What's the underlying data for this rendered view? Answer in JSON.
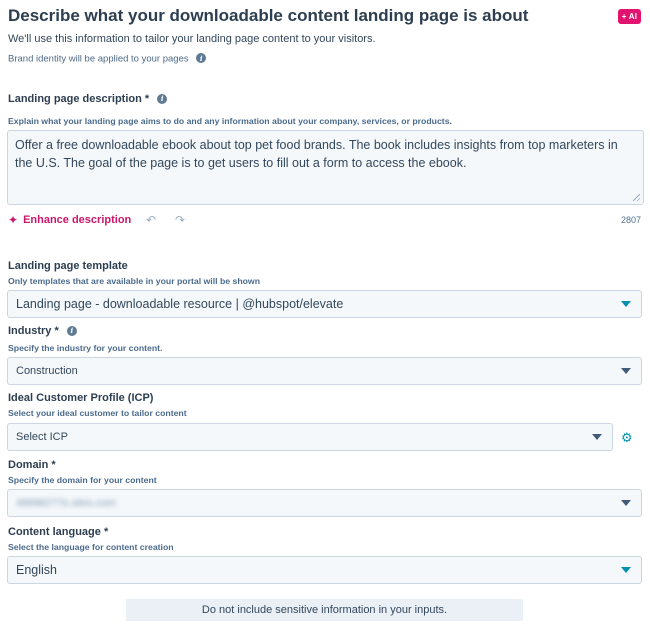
{
  "header": {
    "title": "Describe what your downloadable content landing page is about",
    "ai_badge": "+ AI",
    "subtitle": "We'll use this information to tailor your landing page content to your visitors.",
    "brand_note": "Brand identity will be applied to your pages"
  },
  "description": {
    "label": "Landing page description *",
    "help": "Explain what your landing page aims to do and any information about your company, services, or products.",
    "value": "Offer a free downloadable ebook about top pet food brands. The book includes insights from top marketers in the U.S. The goal of the page is to get users to fill out a form to access the ebook.",
    "enhance_label": "Enhance description",
    "char_count": "2807"
  },
  "template": {
    "label": "Landing page template",
    "help": "Only templates that are available in your portal will be shown",
    "value": "Landing page - downloadable resource | @hubspot/elevate"
  },
  "industry": {
    "label": "Industry *",
    "help": "Specify the industry for your content.",
    "value": "Construction"
  },
  "icp": {
    "label": "Ideal Customer Profile (ICP)",
    "help": "Select your ideal customer to tailor content",
    "value": "Select ICP"
  },
  "domain": {
    "label": "Domain *",
    "help": "Specify the domain for your content",
    "value": "48998277e.sites.com"
  },
  "language": {
    "label": "Content language *",
    "help": "Select the language for content creation",
    "value": "English"
  },
  "footer": {
    "notice": "Do not include sensitive information in your inputs."
  },
  "colors": {
    "accent": "#0091ae",
    "ai_pink": "#e2136e",
    "enhance_pink": "#cc166b",
    "field_bg": "#f5f8fa",
    "field_border": "#cbd6e2"
  },
  "icons": [
    "info-icon",
    "sparkle-icon",
    "undo-icon",
    "redo-icon",
    "chevron-down-icon",
    "gear-icon"
  ]
}
